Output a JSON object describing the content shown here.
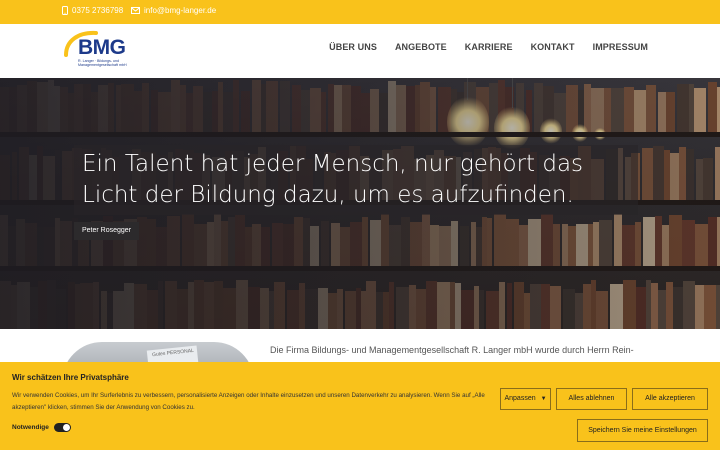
{
  "topbar": {
    "phone": "0375 2736798",
    "email": "info@bmg-langer.de",
    "bg_color": "#f9c21b"
  },
  "header": {
    "logo_text": "BMG",
    "logo_subtitle": "R. Langer · Bildungs- und Managementgesellschaft mbH",
    "nav": [
      {
        "label": "ÜBER UNS"
      },
      {
        "label": "ANGEBOTE"
      },
      {
        "label": "KARRIERE"
      },
      {
        "label": "KONTAKT"
      },
      {
        "label": "IMPRESSUM"
      }
    ]
  },
  "hero": {
    "quote": "Ein Talent hat jeder Mensch, nur gehört das Licht der Bildung dazu, um es aufzufinden.",
    "author": "Peter Rosegger"
  },
  "content": {
    "image_label": "Gutes PERSONAL",
    "intro": "Die Firma Bildungs- und Managementgesellschaft R. Langer mbH wurde durch Herrn Rein-"
  },
  "cookie": {
    "title": "Wir schätzen Ihre Privatsphäre",
    "description": "Wir verwenden Cookies, um Ihr Surferlebnis zu verbessern, personalisierte Anzeigen oder Inhalte einzusetzen und unseren Datenverkehr zu analysieren. Wenn Sie auf „Alle akzeptieren\" klicken, stimmen Sie der Anwendung von Cookies zu.",
    "customize_label": "Anpassen",
    "reject_label": "Alles ablehnen",
    "accept_label": "Alle akzeptieren",
    "save_label": "Speichern Sie meine Einstellungen",
    "necessary_label": "Notwendige",
    "necessary_enabled": true
  }
}
